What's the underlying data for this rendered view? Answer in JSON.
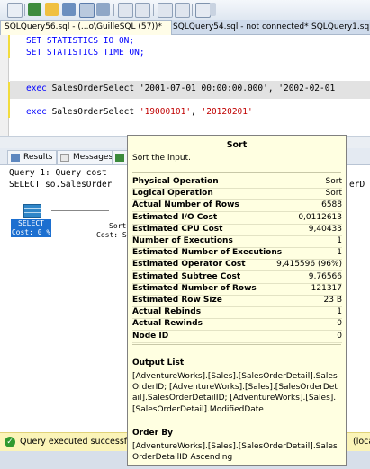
{
  "tabs": [
    {
      "label": "SQLQuery56.sql - (...o\\GuilleSQL (57))*"
    },
    {
      "label": "SQLQuery54.sql - not connected*"
    },
    {
      "label": "SQLQuery1.sql -"
    }
  ],
  "editor": {
    "line1": "SET STATISTICS IO ON;",
    "line2": "SET STATISTICS TIME ON;",
    "exec1_kw": "exec",
    "exec1_proc": " SalesOrderSelect ",
    "exec1_args": "'2001-07-01 00:00:00.000', '2002-02-01",
    "exec2_kw": "exec",
    "exec2_proc": " SalesOrderSelect ",
    "exec2_a": "'19000101'",
    "exec2_comma": ", ",
    "exec2_b": "'20120201'"
  },
  "results": {
    "tab_results": "Results",
    "tab_messages": "Messages",
    "query_line": "Query 1: Query cost",
    "select_line": "SELECT so.SalesOrder",
    "select_line_end": "erD",
    "select_label": "SELECT",
    "select_cost": "Cost: 0 %",
    "sort_label": "Sort",
    "sort_cost": "Cost: S"
  },
  "tooltip": {
    "title": "Sort",
    "description": "Sort the input.",
    "properties": [
      {
        "name": "Physical Operation",
        "value": "Sort"
      },
      {
        "name": "Logical Operation",
        "value": "Sort"
      },
      {
        "name": "Actual Number of Rows",
        "value": "6588"
      },
      {
        "name": "Estimated I/O Cost",
        "value": "0,0112613"
      },
      {
        "name": "Estimated CPU Cost",
        "value": "9,40433"
      },
      {
        "name": "Number of Executions",
        "value": "1"
      },
      {
        "name": "Estimated Number of Executions",
        "value": "1"
      },
      {
        "name": "Estimated Operator Cost",
        "value": "9,415596 (96%)"
      },
      {
        "name": "Estimated Subtree Cost",
        "value": "9,76566"
      },
      {
        "name": "Estimated Number of Rows",
        "value": "121317"
      },
      {
        "name": "Estimated Row Size",
        "value": "23 B"
      },
      {
        "name": "Actual Rebinds",
        "value": "1"
      },
      {
        "name": "Actual Rewinds",
        "value": "0"
      },
      {
        "name": "Node ID",
        "value": "0"
      }
    ],
    "output_list_title": "Output List",
    "output_list_text": "[AdventureWorks].[Sales].[SalesOrderDetail].SalesOrderID; [AdventureWorks].[Sales].[SalesOrderDetail].SalesOrderDetailID; [AdventureWorks].[Sales].[SalesOrderDetail].ModifiedDate",
    "order_by_title": "Order By",
    "order_by_text": "[AdventureWorks].[Sales].[SalesOrderDetail].SalesOrderDetailID Ascending"
  },
  "status": {
    "text": "Query executed successfully",
    "right": "(loca"
  }
}
